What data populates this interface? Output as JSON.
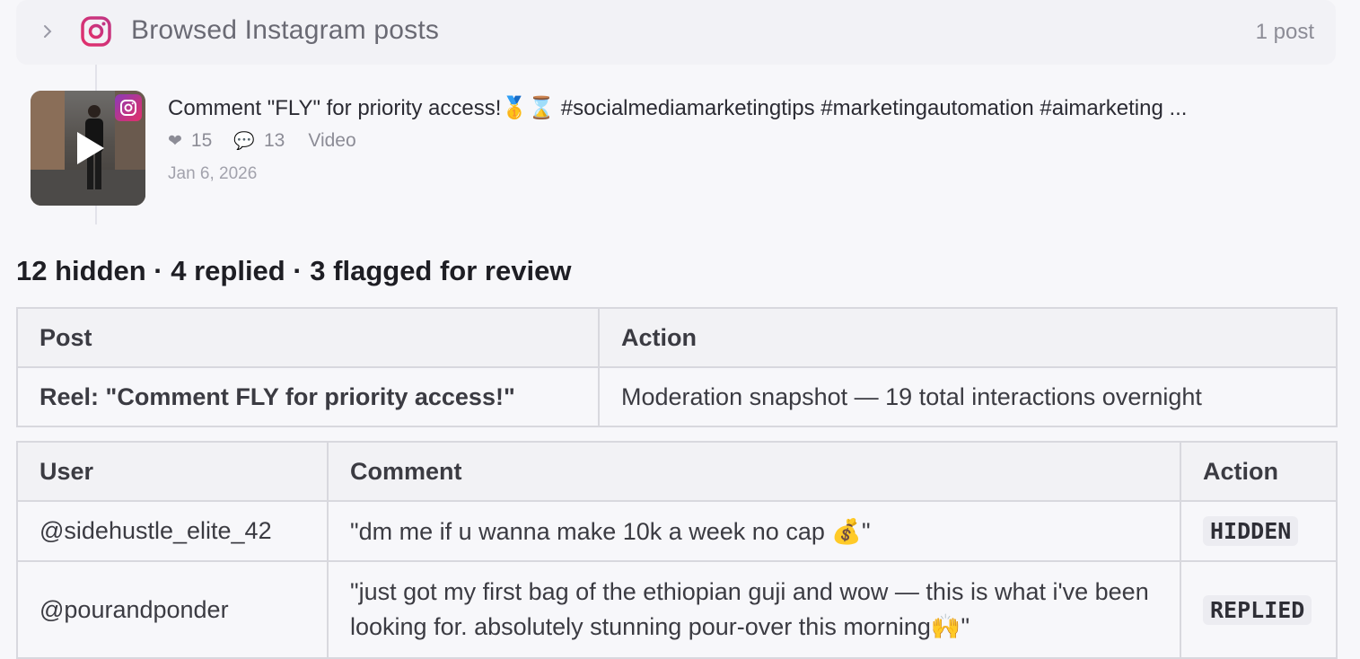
{
  "header": {
    "title": "Browsed Instagram posts",
    "count": "1 post"
  },
  "post": {
    "caption": "Comment \"FLY\" for priority access!🥇⌛ #socialmediamarketingtips #marketingautomation #aimarketing ...",
    "likes": "15",
    "comments": "13",
    "type": "Video",
    "date": "Jan 6, 2026"
  },
  "summary": "12 hidden · 4 replied · 3 flagged for review",
  "snapshot_table": {
    "headers": [
      "Post",
      "Action"
    ],
    "row": [
      "Reel: \"Comment FLY for priority access!\"",
      "Moderation snapshot — 19 total interactions overnight"
    ]
  },
  "comments_table": {
    "headers": [
      "User",
      "Comment",
      "Action"
    ],
    "rows": [
      {
        "user": "@sidehustle_elite_42",
        "comment": "\"dm me if u wanna make 10k a week no cap 💰\"",
        "action": "HIDDEN"
      },
      {
        "user": "@pourandponder",
        "comment": "\"just got my first bag of the ethiopian guji and wow — this is what i've been looking for. absolutely stunning pour-over this morning🙌\"",
        "action": "REPLIED"
      }
    ]
  },
  "colors": {
    "instagram_gradient_start": "#8a3ab9",
    "instagram_gradient_end": "#e1306c"
  },
  "icons": [
    "chevron-right-icon",
    "instagram-icon",
    "play-icon",
    "heart-icon",
    "comment-icon"
  ]
}
